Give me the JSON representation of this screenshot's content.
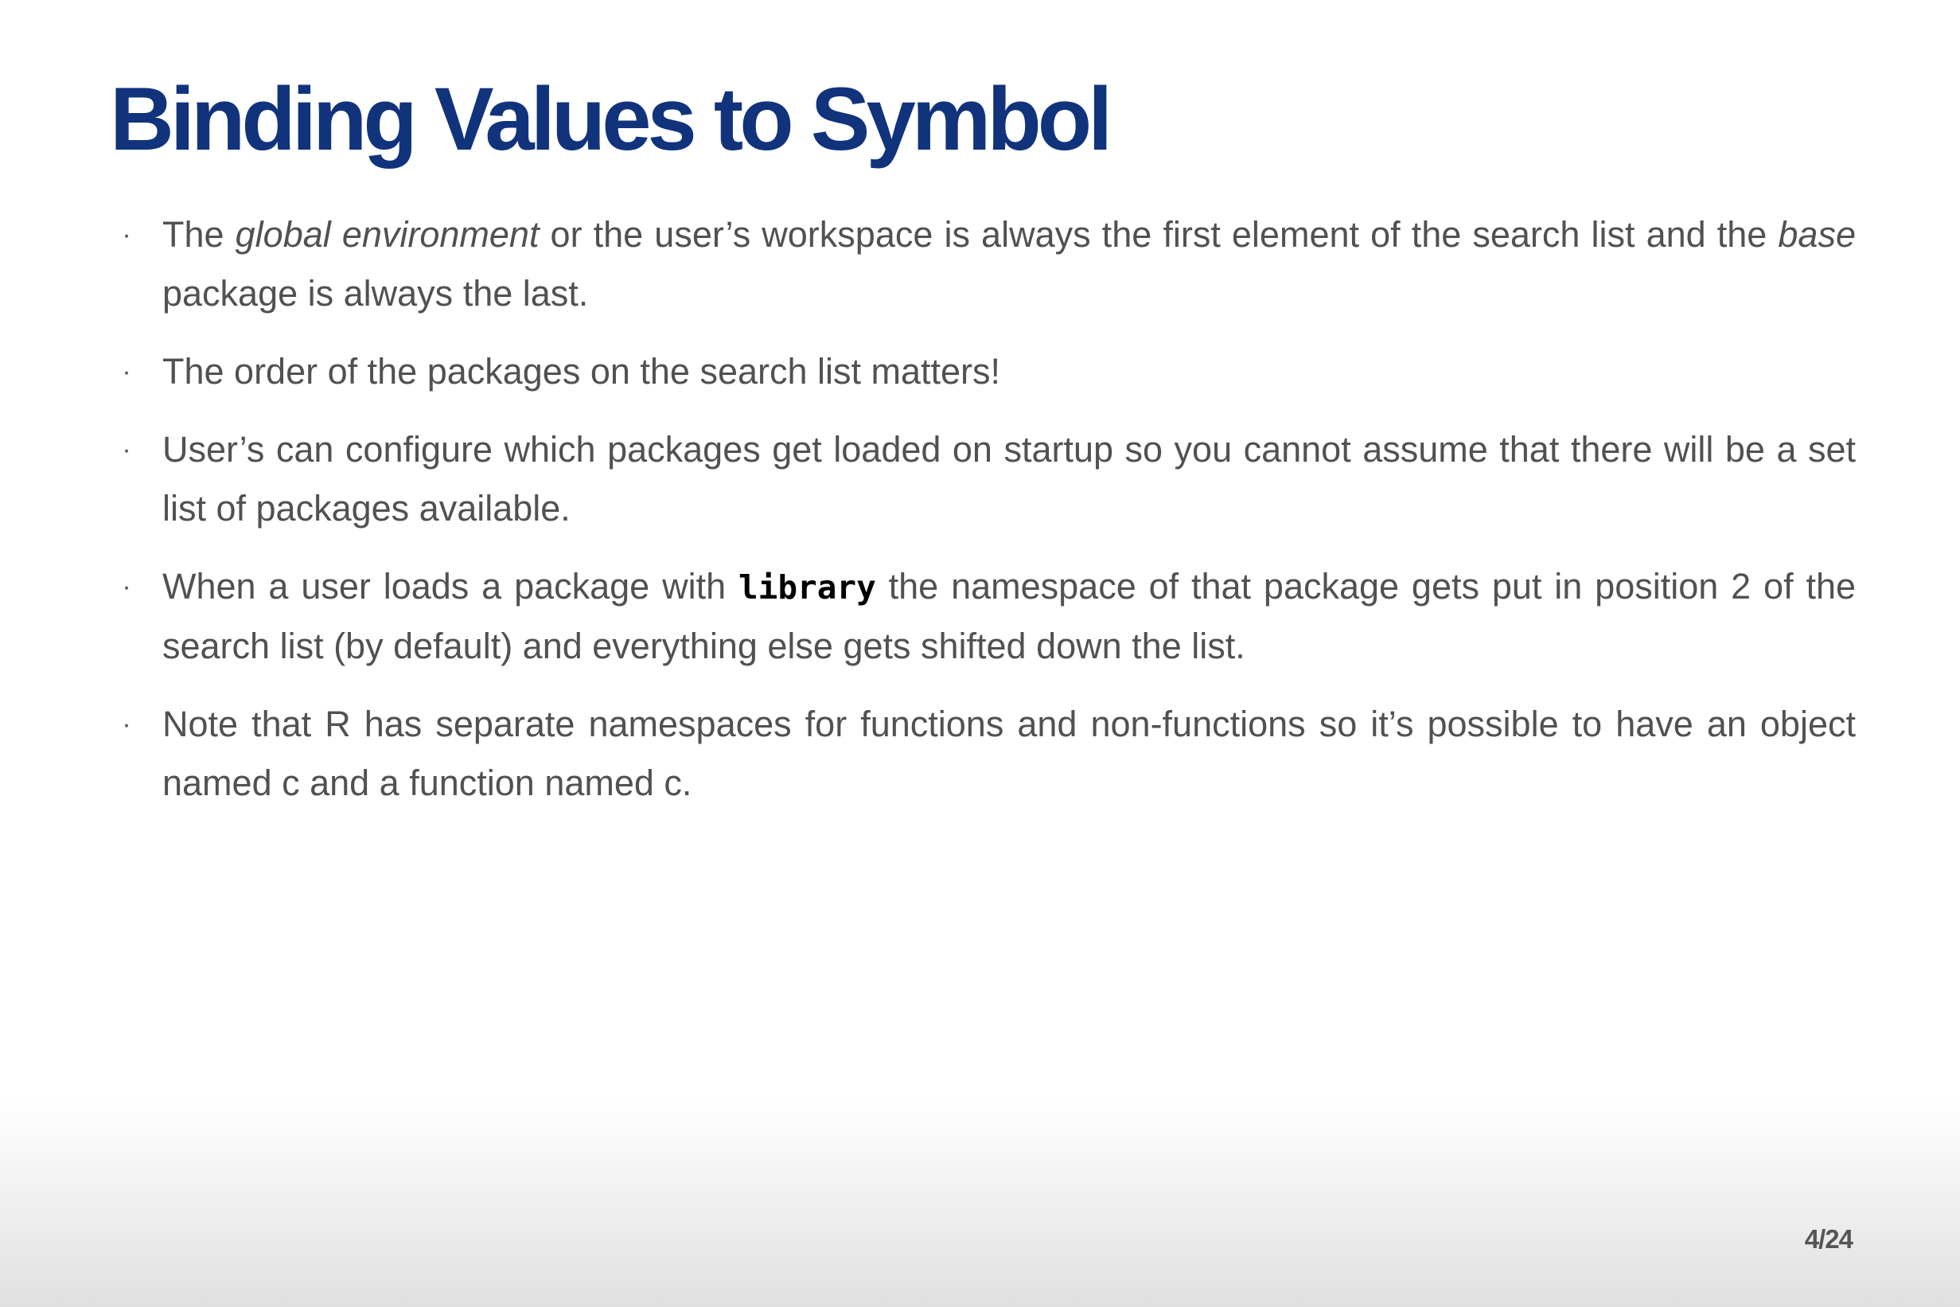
{
  "slide": {
    "title": "Binding Values to Symbol",
    "bullet_marker": "·",
    "bullets": [
      {
        "t1": "The ",
        "em1": "global environment",
        "t2": " or the user’s workspace is always the first element of the search list and the ",
        "em2": "base",
        "t3": " package is always the last."
      },
      {
        "text": "The order of the packages on the search list matters!"
      },
      {
        "text": "User’s can configure which packages get loaded on startup so you cannot assume that there will be a set list of packages available."
      },
      {
        "t1": "When a user loads a package with ",
        "code": "library",
        "t2": " the namespace of that package gets put in position 2 of the search list (by default) and everything else gets shifted down the list."
      },
      {
        "text": "Note that R has separate namespaces for functions and non-functions so it’s possible to have an object named c and a function named c."
      }
    ],
    "page_number": "4/24"
  }
}
